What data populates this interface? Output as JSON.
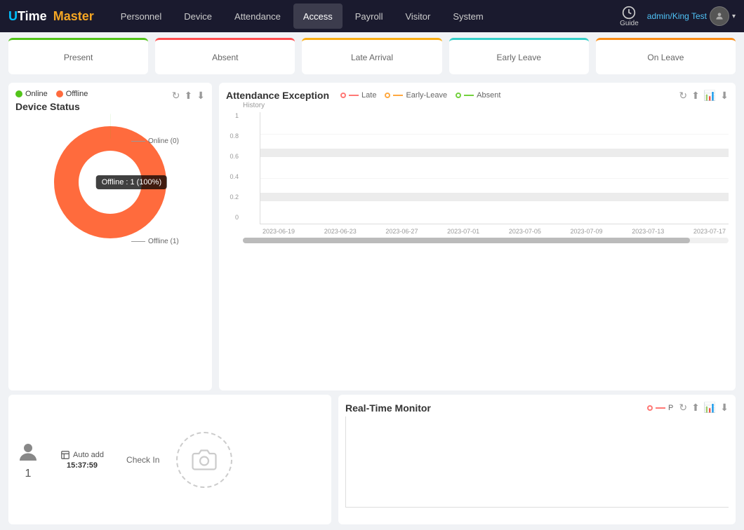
{
  "app": {
    "logo_u": "U",
    "logo_time": "Time",
    "logo_master": "Master"
  },
  "navbar": {
    "items": [
      {
        "id": "personnel",
        "label": "Personnel",
        "active": false
      },
      {
        "id": "device",
        "label": "Device",
        "active": false
      },
      {
        "id": "attendance",
        "label": "Attendance",
        "active": false
      },
      {
        "id": "access",
        "label": "Access",
        "active": true
      },
      {
        "id": "payroll",
        "label": "Payroll",
        "active": false
      },
      {
        "id": "visitor",
        "label": "Visitor",
        "active": false
      },
      {
        "id": "system",
        "label": "System",
        "active": false
      }
    ],
    "guide_label": "Guide",
    "user_label": "admin/King Test"
  },
  "status_cards": [
    {
      "id": "present",
      "label": "Present",
      "class": "present"
    },
    {
      "id": "absent",
      "label": "Absent",
      "class": "absent"
    },
    {
      "id": "late",
      "label": "Late Arrival",
      "class": "late"
    },
    {
      "id": "early",
      "label": "Early Leave",
      "class": "early"
    },
    {
      "id": "on-leave",
      "label": "On Leave",
      "class": "on-leave"
    }
  ],
  "device_status": {
    "title": "Device Status",
    "legend": {
      "online": "Online",
      "offline": "Offline"
    },
    "online_label": "Online (0)",
    "offline_label": "Offline (1)",
    "tooltip": "Offline : 1 (100%)"
  },
  "attendance_exception": {
    "title": "Attendance Exception",
    "history_label": "History",
    "legend": {
      "late": "Late",
      "early_leave": "Early-Leave",
      "absent": "Absent"
    },
    "y_axis": [
      "1",
      "0.8",
      "0.6",
      "0.4",
      "0.2",
      "0"
    ],
    "x_axis": [
      "2023-06-19",
      "2023-06-23",
      "2023-06-27",
      "2023-07-01",
      "2023-07-05",
      "2023-07-09",
      "2023-07-13",
      "2023-07-17"
    ]
  },
  "checkin": {
    "user_count": "1",
    "auto_label": "Auto add",
    "time": "15:37:59",
    "check_in_label": "Check In"
  },
  "real_time_monitor": {
    "title": "Real-Time Monitor",
    "legend_p": "P"
  }
}
